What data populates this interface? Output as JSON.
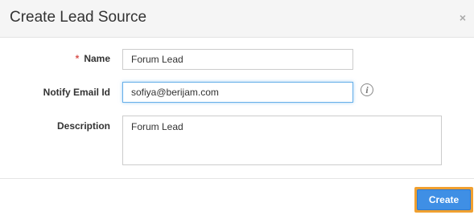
{
  "dialog": {
    "title": "Create Lead Source",
    "close_label": "×"
  },
  "form": {
    "name": {
      "required_mark": "*",
      "label": "Name",
      "value": "Forum Lead"
    },
    "notify_email": {
      "label": "Notify Email Id",
      "value": "sofiya@berijam.com",
      "info_icon": "i"
    },
    "description": {
      "label": "Description",
      "value": "Forum Lead"
    }
  },
  "footer": {
    "create_label": "Create"
  }
}
